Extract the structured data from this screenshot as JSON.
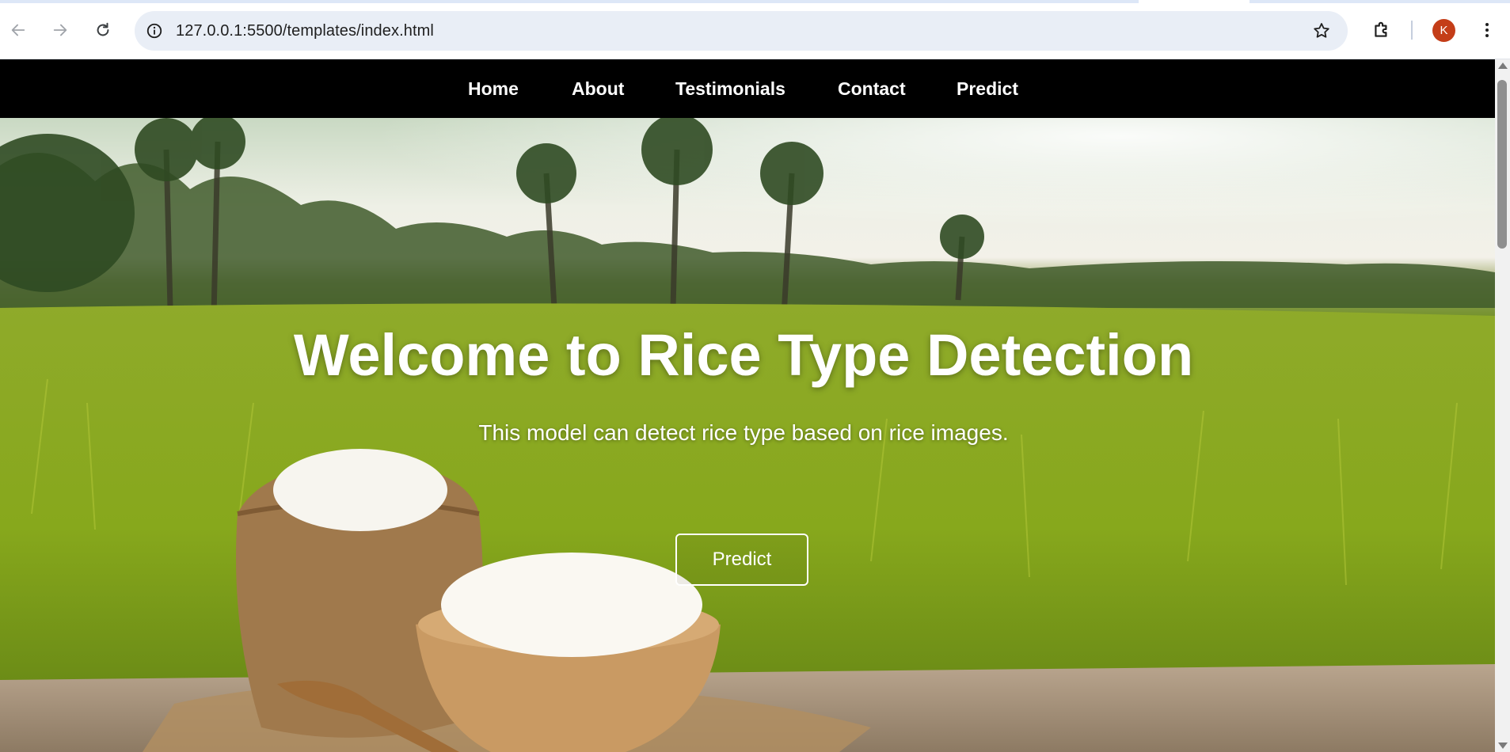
{
  "browser": {
    "url": "127.0.0.1:5500/templates/index.html",
    "profile_initial": "K",
    "icons": {
      "back": "arrow-left-icon",
      "forward": "arrow-right-icon",
      "reload": "reload-icon",
      "site_info": "info-icon",
      "bookmark": "star-icon",
      "extensions": "puzzle-icon",
      "menu": "kebab-menu-icon"
    }
  },
  "nav": {
    "links": [
      "Home",
      "About",
      "Testimonials",
      "Contact",
      "Predict"
    ]
  },
  "hero": {
    "title": "Welcome to Rice Type Detection",
    "subtitle": "This model can detect rice type based on rice images.",
    "button_label": "Predict"
  },
  "colors": {
    "nav_background": "#000000",
    "nav_text": "#ffffff",
    "avatar": "#c43d18",
    "omnibox": "#e9eef6"
  }
}
